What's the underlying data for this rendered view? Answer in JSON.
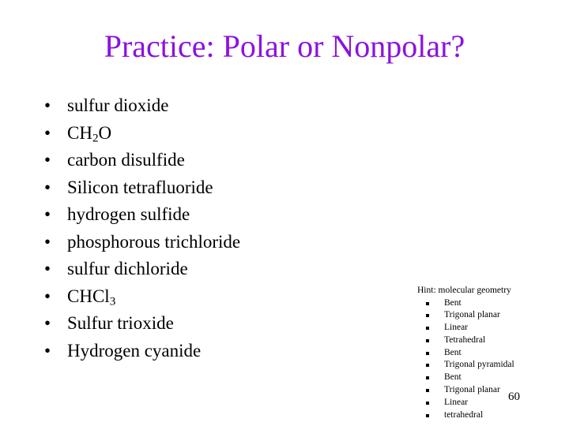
{
  "slide": {
    "title": "Practice: Polar or Nonpolar?",
    "title_color": "#8B12E0",
    "background_color": "#ffffff",
    "text_color": "#000000",
    "slide_number": "60"
  },
  "molecules": {
    "bullet_glyph": "•",
    "items": [
      {
        "text": "sulfur dioxide",
        "formula_parts": null
      },
      {
        "text": "CH2O",
        "formula_parts": {
          "pre": "CH",
          "sub": "2",
          "post": "O"
        }
      },
      {
        "text": "carbon disulfide",
        "formula_parts": null
      },
      {
        "text": "Silicon tetrafluoride",
        "formula_parts": null
      },
      {
        "text": "hydrogen sulfide",
        "formula_parts": null
      },
      {
        "text": "phosphorous trichloride",
        "formula_parts": null
      },
      {
        "text": "sulfur dichloride",
        "formula_parts": null
      },
      {
        "text": "CHCl3",
        "formula_parts": {
          "pre": "CHCl",
          "sub": "3",
          "post": ""
        }
      },
      {
        "text": "Sulfur trioxide",
        "formula_parts": null
      },
      {
        "text": "Hydrogen cyanide",
        "formula_parts": null
      }
    ]
  },
  "hint": {
    "title": "Hint: molecular geometry",
    "items": [
      "Bent",
      "Trigonal planar",
      "Linear",
      "Tetrahedral",
      "Bent",
      "Trigonal pyramidal",
      "Bent",
      "Trigonal planar",
      "Linear",
      "tetrahedral"
    ]
  }
}
